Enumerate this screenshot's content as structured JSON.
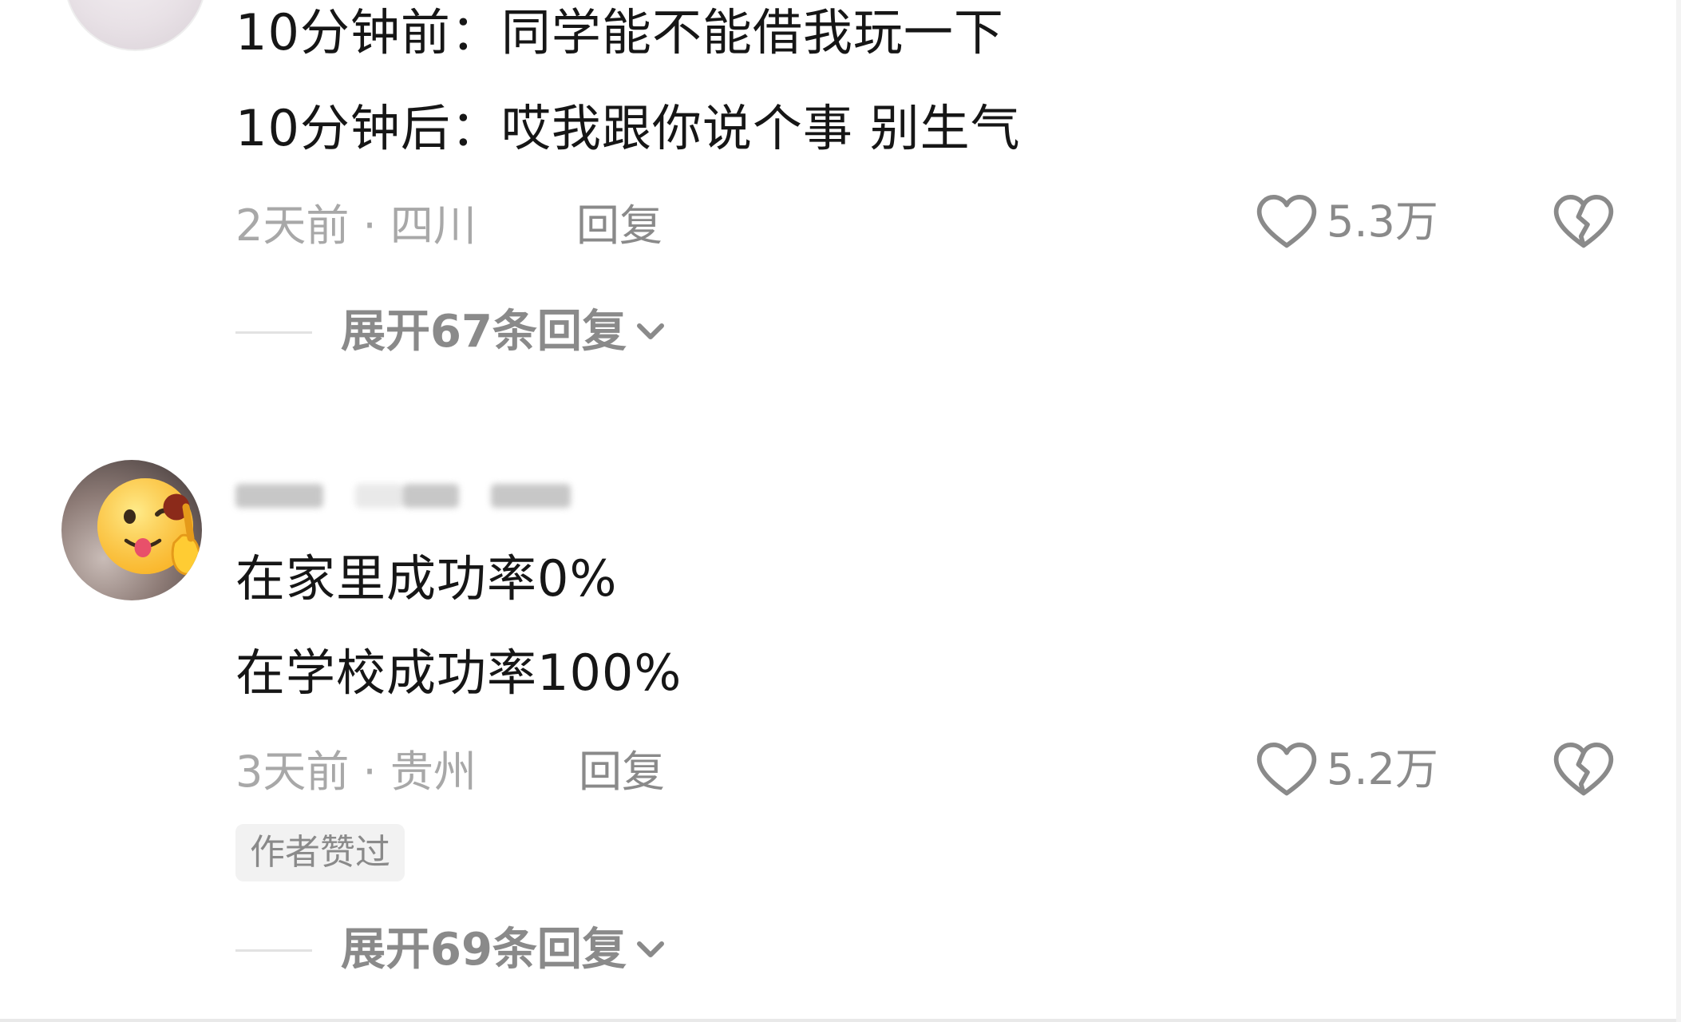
{
  "comments": [
    {
      "lines": [
        "10分钟前：同学能不能借我玩一下",
        "10分钟后：哎我跟你说个事 别生气"
      ],
      "time": "2天前",
      "location": "四川",
      "reply_label": "回复",
      "likes": "5.3万",
      "expand_label": "展开67条回复"
    },
    {
      "lines": [
        "在家里成功率0%",
        "在学校成功率100%"
      ],
      "time": "3天前",
      "location": "贵州",
      "reply_label": "回复",
      "likes": "5.2万",
      "author_badge": "作者赞过",
      "expand_label": "展开69条回复"
    }
  ],
  "icons": {
    "like": "heart-outline-icon",
    "dislike": "broken-heart-icon",
    "expand": "chevron-down-icon",
    "avatar_emoji": "tongue-out-thumbs-up-emoji"
  },
  "colors": {
    "text": "#161616",
    "meta": "#a8a8a8",
    "secondary": "#8a8a8a",
    "badge_bg": "#f2f2f2"
  }
}
